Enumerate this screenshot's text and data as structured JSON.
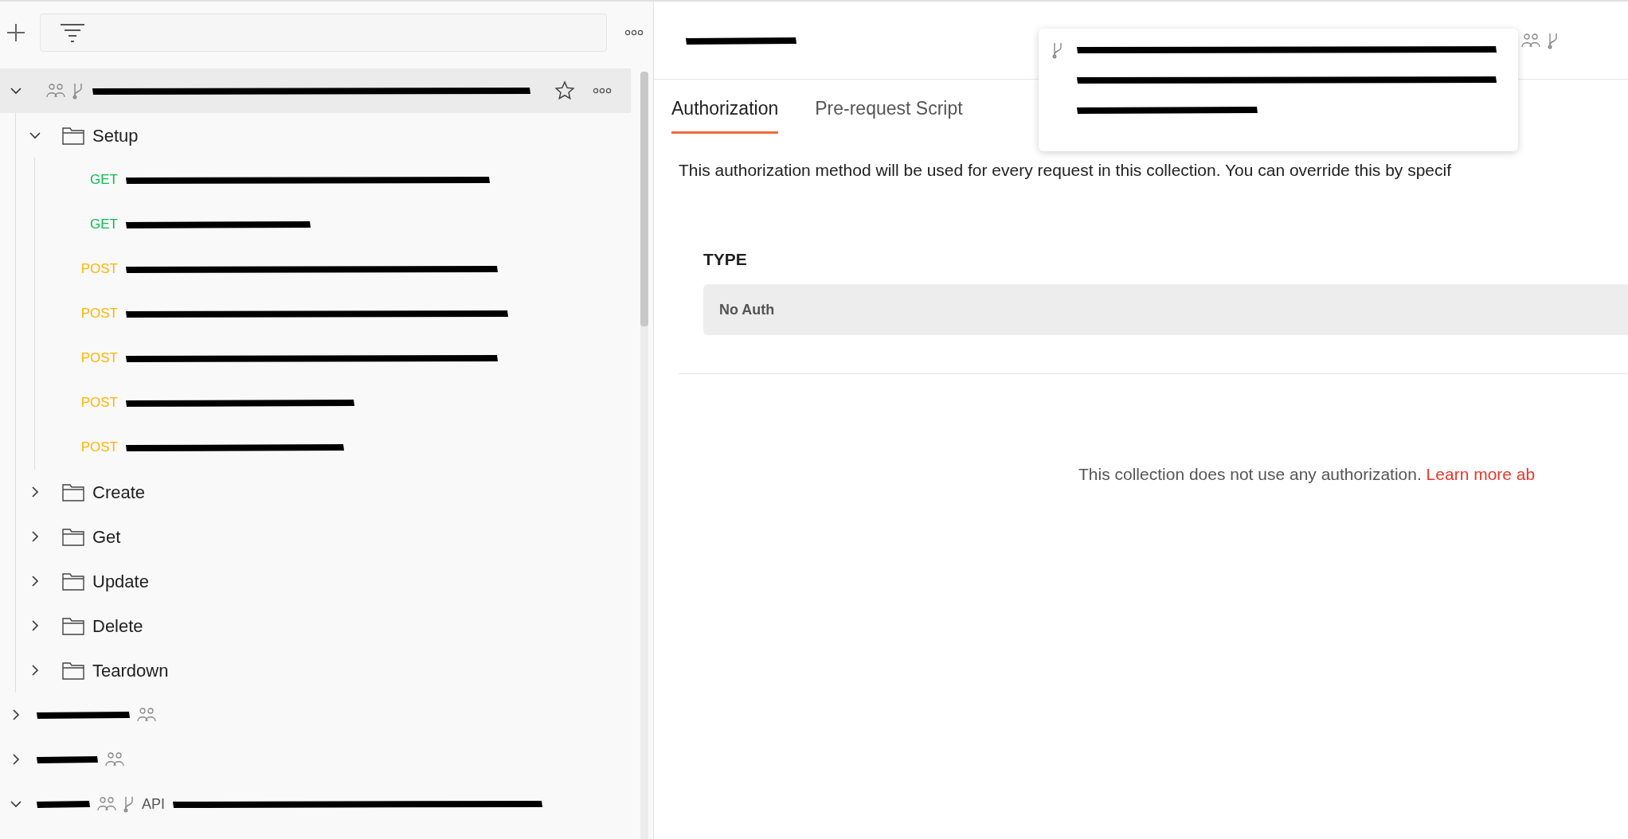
{
  "sidebar": {
    "collections": [
      {
        "expanded": true,
        "shared": true,
        "forked": true,
        "starred": false,
        "children": [
          {
            "kind": "folder",
            "name": "Setup",
            "expanded": true,
            "children": [
              {
                "kind": "request",
                "method": "GET"
              },
              {
                "kind": "request",
                "method": "GET"
              },
              {
                "kind": "request",
                "method": "POST"
              },
              {
                "kind": "request",
                "method": "POST"
              },
              {
                "kind": "request",
                "method": "POST"
              },
              {
                "kind": "request",
                "method": "POST"
              },
              {
                "kind": "request",
                "method": "POST"
              }
            ]
          },
          {
            "kind": "folder",
            "name": "Create",
            "expanded": false
          },
          {
            "kind": "folder",
            "name": "Get",
            "expanded": false
          },
          {
            "kind": "folder",
            "name": "Update",
            "expanded": false
          },
          {
            "kind": "folder",
            "name": "Delete",
            "expanded": false
          },
          {
            "kind": "folder",
            "name": "Teardown",
            "expanded": false
          }
        ]
      },
      {
        "expanded": false,
        "shared": true,
        "forked": false
      },
      {
        "expanded": false,
        "shared": true,
        "forked": false
      },
      {
        "expanded": true,
        "shared": true,
        "forked": true,
        "fork_label": "API"
      }
    ]
  },
  "header": {
    "shared": true,
    "forked": true
  },
  "tabs": [
    {
      "label": "Authorization",
      "selected": true
    },
    {
      "label": "Pre-request Script",
      "selected": false
    }
  ],
  "description": "This authorization method will be used for every request in this collection. You can override this by specif",
  "auth": {
    "label": "TYPE",
    "value": "No Auth"
  },
  "notice": {
    "text": "This collection does not use any authorization.",
    "link": "Learn more ab"
  }
}
